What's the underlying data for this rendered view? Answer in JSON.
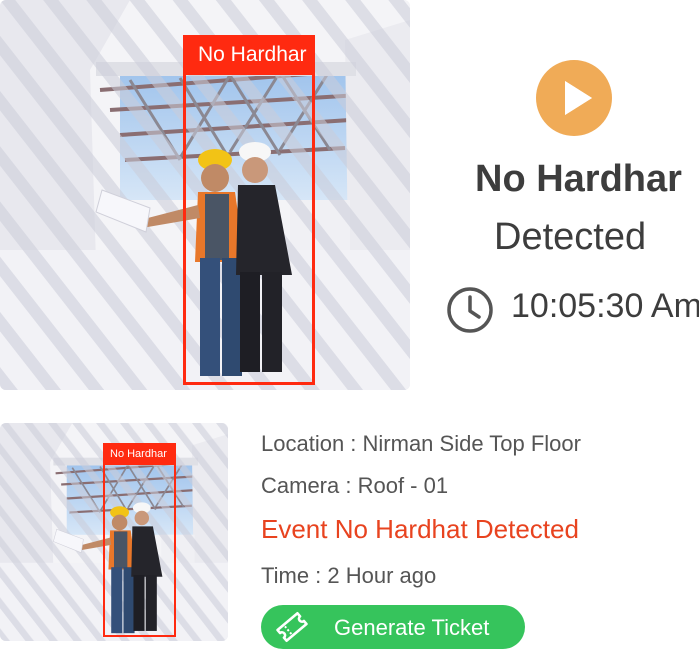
{
  "alert": {
    "title": "No Hardhar",
    "subtitle": "Detected",
    "time": "10:05:30 Am"
  },
  "snapshot": {
    "detection_label": "No Hardhar"
  },
  "thumbnail": {
    "detection_label": "No Hardhar"
  },
  "details": {
    "location": "Location : Nirman Side Top Floor",
    "camera": "Camera : Roof - 01",
    "event": "Event No Hardhat Detected",
    "time": "Time : 2 Hour ago"
  },
  "actions": {
    "generate_ticket_label": "Generate Ticket"
  },
  "colors": {
    "bbox": "#ff2a10",
    "play_button": "#f0ab57",
    "event_text": "#e8431f",
    "ticket_button": "#36c45c"
  },
  "icons": [
    "play-icon",
    "clock-icon",
    "ticket-icon"
  ]
}
